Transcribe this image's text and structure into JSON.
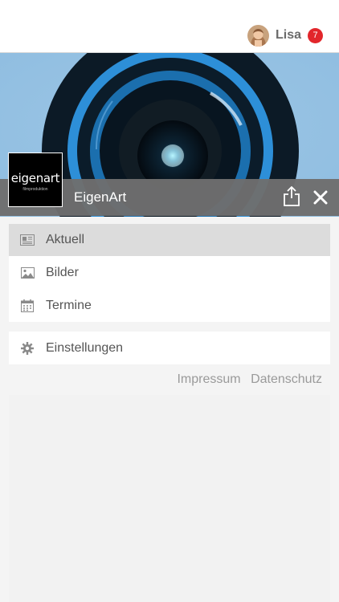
{
  "user": {
    "name": "Lisa",
    "notifications": "7"
  },
  "brand": {
    "title": "EigenArt",
    "logo_text": "eigenart",
    "logo_subtext": "filmproduktion"
  },
  "actions": {
    "share_icon": "share-icon",
    "close_icon": "close-icon"
  },
  "menu_main": [
    {
      "label": "Aktuell",
      "icon": "news-icon",
      "active": true
    },
    {
      "label": "Bilder",
      "icon": "image-icon",
      "active": false
    },
    {
      "label": "Termine",
      "icon": "calendar-icon",
      "active": false
    }
  ],
  "menu_settings": {
    "label": "Einstellungen",
    "icon": "gear-icon"
  },
  "footer_links": {
    "impressum": "Impressum",
    "datenschutz": "Datenschutz"
  },
  "colors": {
    "badge": "#e2262b",
    "accent": "#2d8fd8"
  }
}
